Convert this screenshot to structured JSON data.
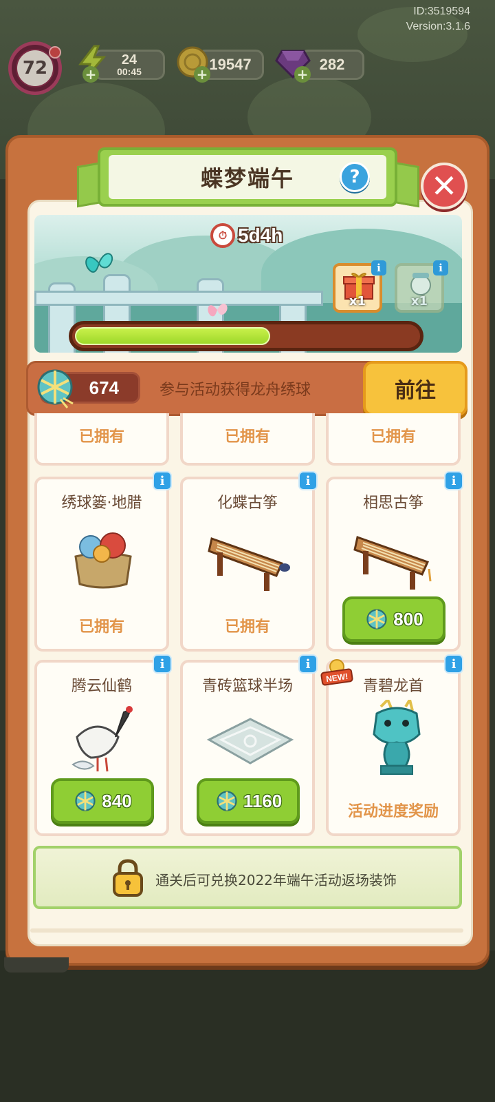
{
  "meta": {
    "id": "ID:3519594",
    "version": "Version:3.1.6"
  },
  "hud": {
    "level": "72",
    "energy": "24",
    "energy_timer": "00:45",
    "coins": "19547",
    "gems": "282"
  },
  "dialog": {
    "title": "蝶梦端午",
    "timer": "5d4h",
    "reward_1_count": "x1",
    "reward_2_count": "x1",
    "progress": 0.57,
    "currency_amount": "674",
    "currency_desc": "参与活动获得龙舟绣球",
    "go_label": "前往"
  },
  "row0": [
    {
      "status": "已拥有"
    },
    {
      "status": "已拥有"
    },
    {
      "status": "已拥有"
    }
  ],
  "row1": [
    {
      "name": "绣球篓·地腊",
      "status": "已拥有"
    },
    {
      "name": "化蝶古筝",
      "status": "已拥有"
    },
    {
      "name": "相思古筝",
      "price": "800"
    }
  ],
  "row2": [
    {
      "name": "腾云仙鹤",
      "price": "840"
    },
    {
      "name": "青砖篮球半场",
      "price": "1160"
    },
    {
      "name": "青碧龙首",
      "status": "活动进度奖励",
      "tag": "NEW!"
    }
  ],
  "lock_text": "通关后可兑换2022年端午活动返场装饰",
  "colors": {
    "accent_green": "#8fce34",
    "panel_orange": "#c7723e",
    "owned_orange": "#e2954a"
  }
}
